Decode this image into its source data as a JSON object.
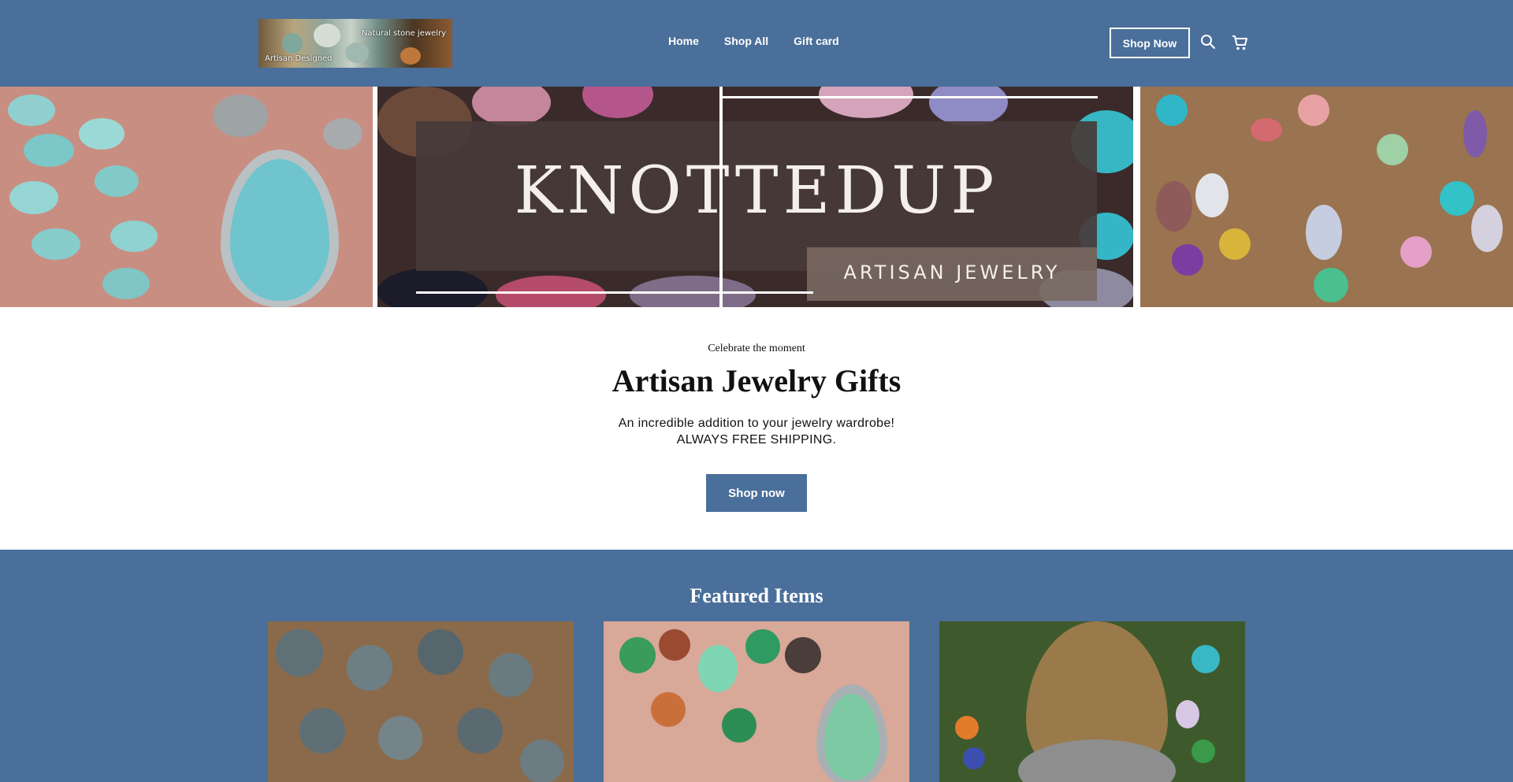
{
  "header": {
    "logo": {
      "text_top": "Natural stone jewelry",
      "text_bottom": "Artisan Designed"
    },
    "nav": [
      {
        "label": "Home"
      },
      {
        "label": "Shop All"
      },
      {
        "label": "Gift card"
      }
    ],
    "shop_now_label": "Shop Now",
    "icons": [
      "search-icon",
      "cart-icon"
    ]
  },
  "banner": {
    "brand_title": "KNOTTEDUP",
    "brand_subtitle": "ARTISAN JEWELRY"
  },
  "hero": {
    "eyebrow": "Celebrate the moment",
    "title": "Artisan Jewelry Gifts",
    "description_line1": "An incredible addition to your jewelry wardrobe!",
    "description_line2": "ALWAYS FREE SHIPPING.",
    "button_label": "Shop now"
  },
  "featured": {
    "title": "Featured Items"
  },
  "colors": {
    "brand_blue": "#4a6f9a",
    "white": "#ffffff",
    "text": "#111111"
  }
}
